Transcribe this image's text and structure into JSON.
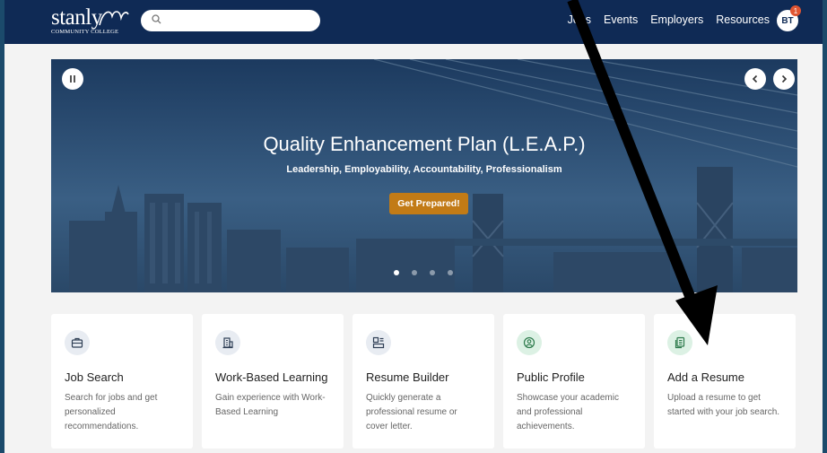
{
  "header": {
    "logo_word": "stanly",
    "logo_sub": "Community College",
    "search_placeholder": "",
    "nav": [
      "Jobs",
      "Events",
      "Employers",
      "Resources"
    ],
    "avatar_initials": "BT",
    "notification_count": "1"
  },
  "hero": {
    "title": "Quality Enhancement Plan (L.E.A.P.)",
    "subtitle": "Leadership, Employability, Accountability, Professionalism",
    "button": "Get Prepared!",
    "slide_count": 4,
    "active_slide": 0
  },
  "cards": [
    {
      "title": "Job Search",
      "desc": "Search for jobs and get personalized recommendations.",
      "icon": "briefcase-icon",
      "icon_bg": "#e8ecf2"
    },
    {
      "title": "Work-Based Learning",
      "desc": "Gain experience with Work-Based Learning",
      "icon": "building-icon",
      "icon_bg": "#e8ecf2"
    },
    {
      "title": "Resume Builder",
      "desc": "Quickly generate a professional resume or cover letter.",
      "icon": "resume-layout-icon",
      "icon_bg": "#e8ecf2"
    },
    {
      "title": "Public Profile",
      "desc": "Showcase your academic and professional achievements.",
      "icon": "profile-icon",
      "icon_bg": "#dcf1e4"
    },
    {
      "title": "Add a Resume",
      "desc": "Upload a resume to get started with your job search.",
      "icon": "document-icon",
      "icon_bg": "#dcf1e4"
    }
  ],
  "colors": {
    "nav_bg": "#0f2a55",
    "accent_button": "#c27b16",
    "badge": "#e05532"
  }
}
